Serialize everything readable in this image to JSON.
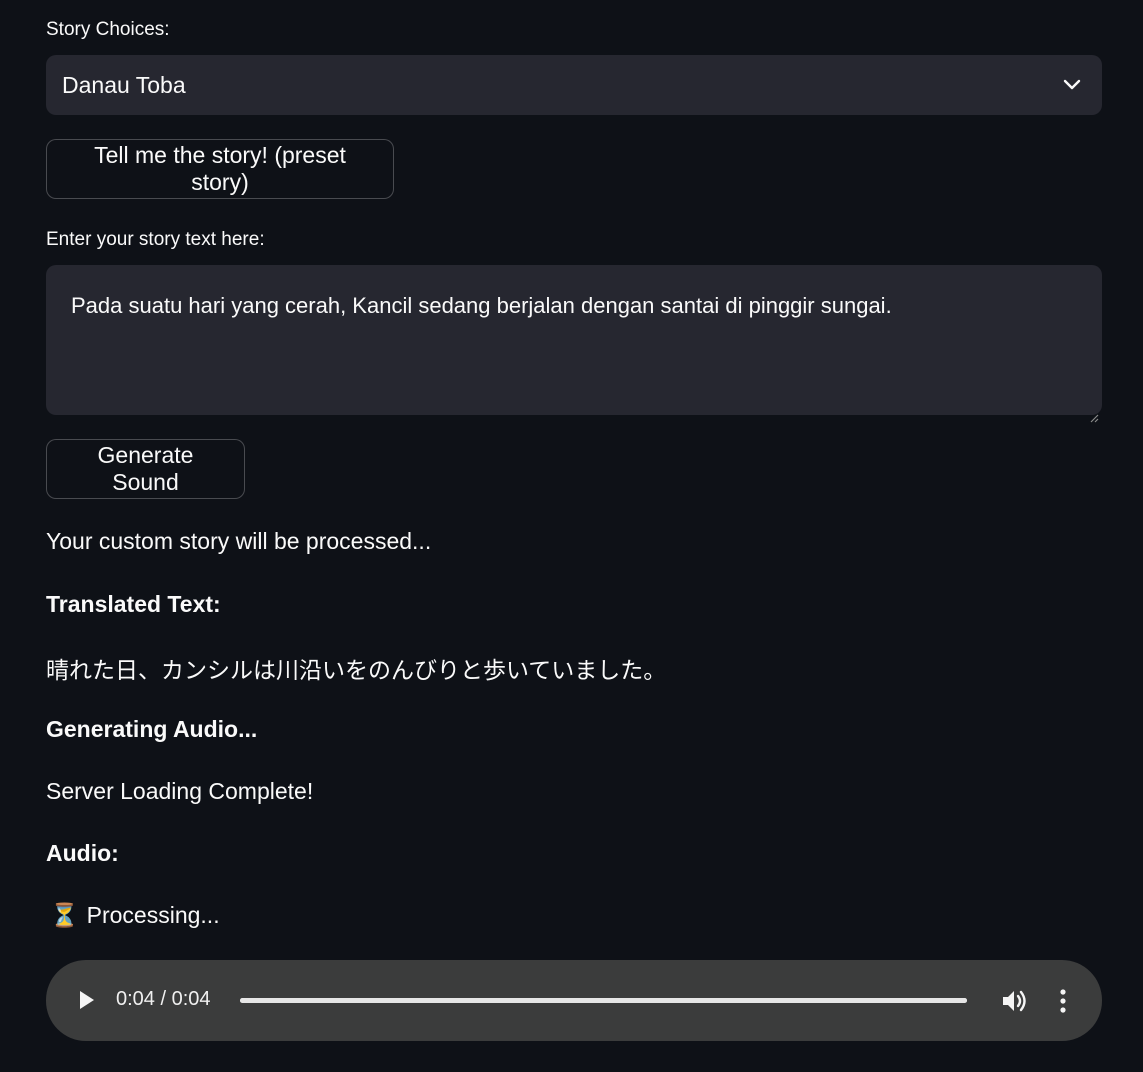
{
  "story_select": {
    "label": "Story Choices:",
    "selected": "Danau Toba"
  },
  "preset_button": {
    "label": "Tell me the story! (preset story)"
  },
  "story_input": {
    "label": "Enter your story text here:",
    "value": "Pada suatu hari yang cerah, Kancil sedang berjalan dengan santai di pinggir sungai."
  },
  "generate_button": {
    "label": "Generate Sound"
  },
  "output": {
    "processing_note": "Your custom story will be processed...",
    "translated_heading": "Translated Text:",
    "translated_text": "晴れた日、カンシルは川沿いをのんびりと歩いていました。",
    "generating_heading": "Generating Audio...",
    "server_status": "Server Loading Complete!",
    "audio_heading": "Audio:",
    "processing_icon": "hourglass-icon",
    "processing_glyph": "⏳",
    "processing_text": "Processing..."
  },
  "audio_player": {
    "time": "0:04 / 0:04",
    "progress": 1.0,
    "icons": [
      "play-icon",
      "volume-icon",
      "more-options-icon"
    ]
  },
  "colors": {
    "background": "#0e1117",
    "input_background": "#262730",
    "text": "#fafafa",
    "player_background": "#3b3c3c"
  }
}
